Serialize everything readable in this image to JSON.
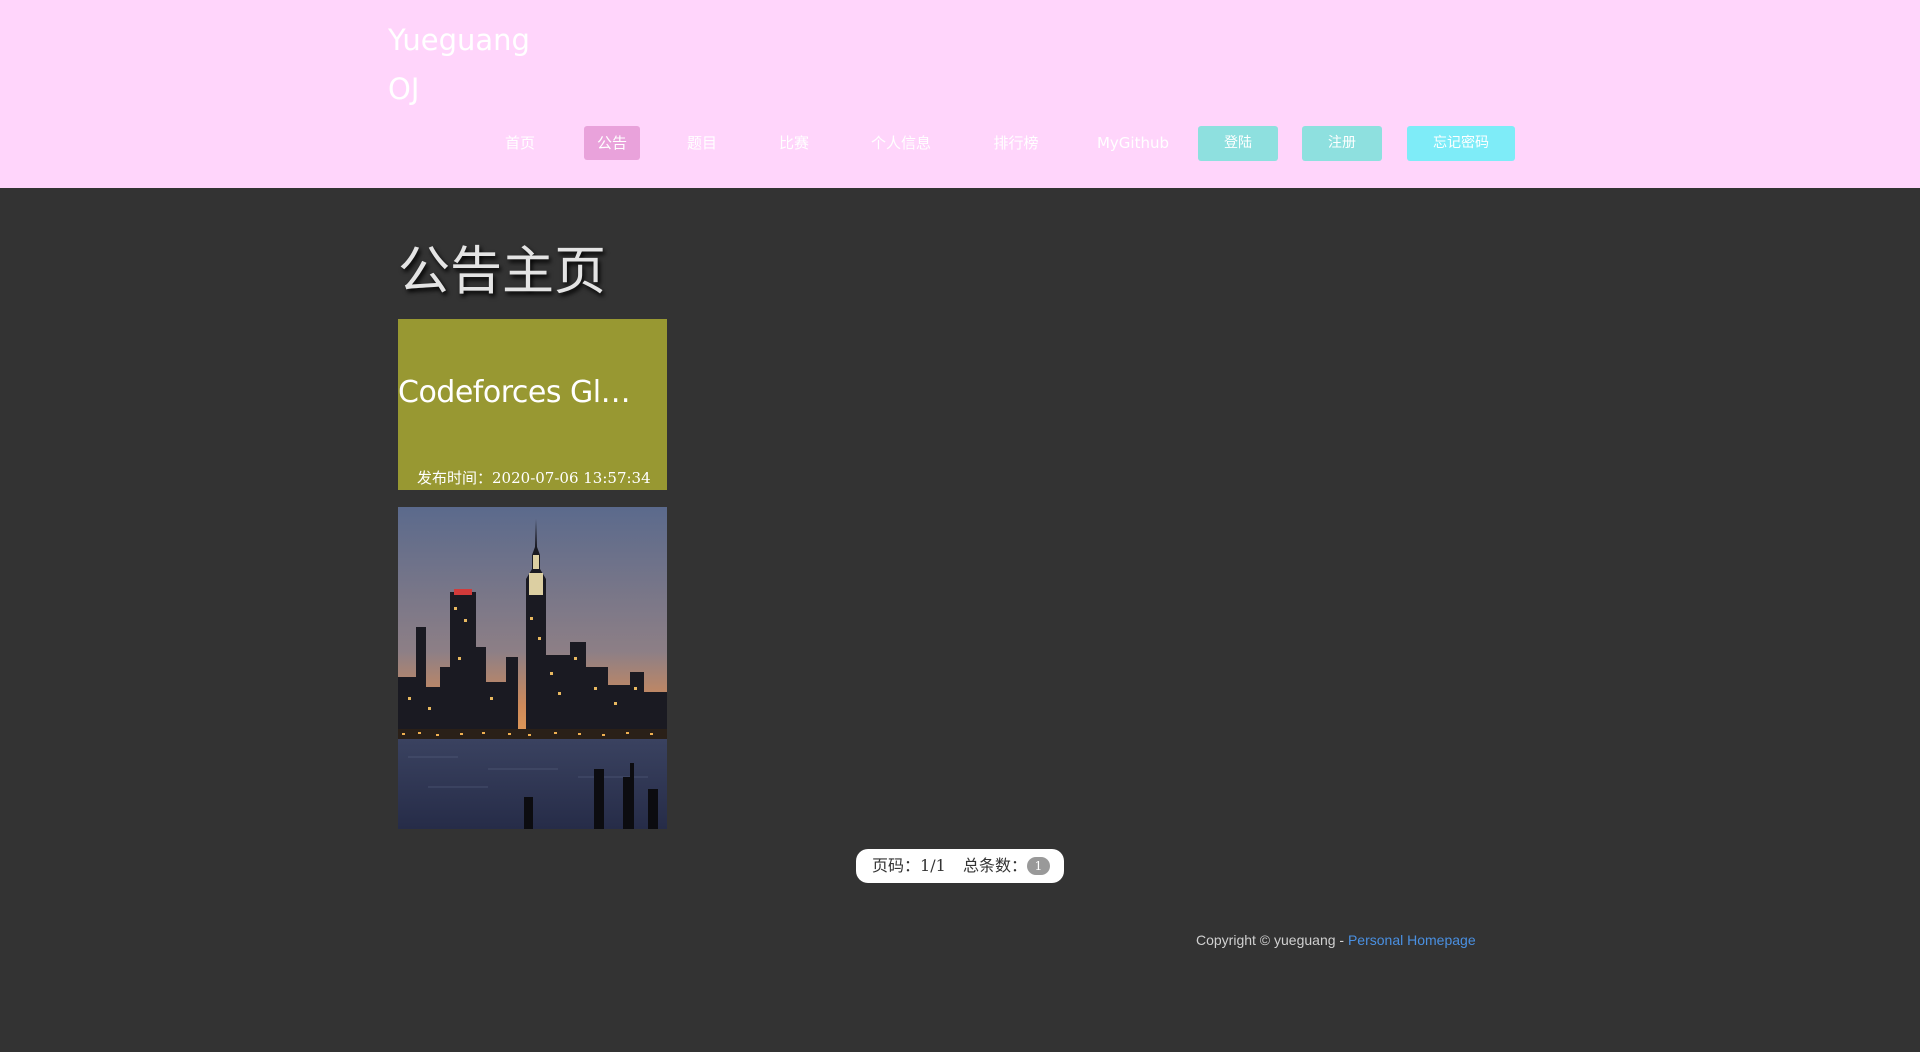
{
  "header": {
    "brand_line1": "Yueguang",
    "brand_line2": "OJ",
    "background_color": "#ffd5fb"
  },
  "nav": {
    "items": [
      {
        "label": "首页",
        "active": false
      },
      {
        "label": "公告",
        "active": true
      },
      {
        "label": "题目",
        "active": false
      },
      {
        "label": "比赛",
        "active": false
      },
      {
        "label": "个人信息",
        "active": false
      },
      {
        "label": "排行榜",
        "active": false
      },
      {
        "label": "MyGithub",
        "active": false
      }
    ],
    "active_color": "#e9a2db"
  },
  "auth": {
    "login_label": "登陆",
    "register_label": "注册",
    "forgot_label": "忘记密码",
    "login_color": "#8ee0df",
    "register_color": "#8ee0df",
    "forgot_color": "#7eecf8"
  },
  "main": {
    "page_title": "公告主页",
    "notices": [
      {
        "title": "Codeforces Global Round",
        "date_label": "发布时间：",
        "date": "2020-07-06 13:57:34",
        "card_color": "#989832"
      }
    ],
    "image_subject": "city-skyline-at-dusk"
  },
  "pagination": {
    "page_label": "页码：",
    "page_value": "1/1",
    "total_label": "总条数：",
    "total_count": "1"
  },
  "footer": {
    "copyright": "Copyright © yueguang - ",
    "link_text": "Personal Homepage",
    "link_color": "#4a90e2"
  },
  "colors": {
    "page_background": "#333333"
  }
}
